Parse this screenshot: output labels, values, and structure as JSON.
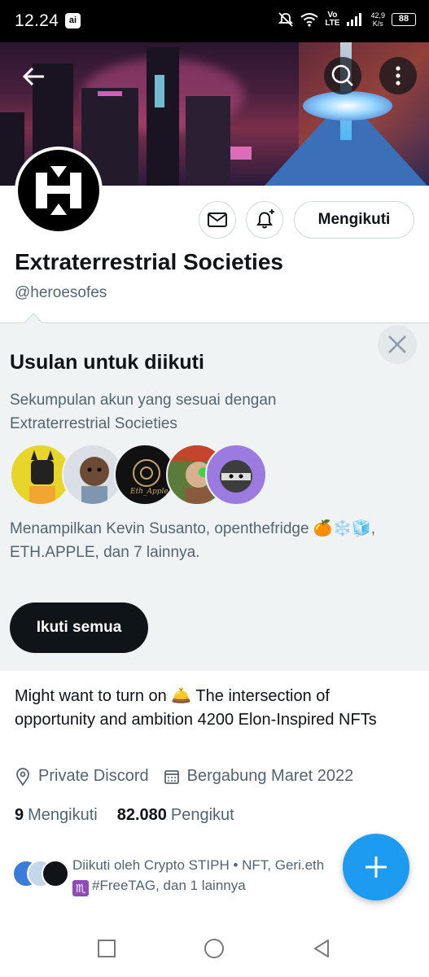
{
  "status_bar": {
    "time": "12.24",
    "ai_badge": "ai",
    "network_volte": "Vo",
    "network_lte": "LTE",
    "speed_value": "42,9",
    "speed_unit": "K/s",
    "battery": "88"
  },
  "profile": {
    "display_name": "Extraterrestrial Societies",
    "handle": "@heroesofes",
    "follow_button": "Mengikuti",
    "bio": "Might want to turn on 🛎️ The intersection of opportunity and ambition 4200 Elon-Inspired NFTs",
    "location": "Private Discord",
    "joined": "Bergabung Maret 2022",
    "following_count": "9",
    "following_label": "Mengikuti",
    "followers_count": "82.080",
    "followers_label": "Pengikut",
    "followed_by_line1": "Diikuti oleh Crypto STIPH • NFT, Geri.eth",
    "followed_by_line2": "#FreeTAG, dan 1 lainnya"
  },
  "suggestions": {
    "title": "Usulan untuk diikuti",
    "subtitle": "Sekumpulan akun yang sesuai dengan Extraterrestrial Societies",
    "showing": "Menampilkan Kevin Susanto, openthefridge 🍊❄️🧊, ETH.APPLE, dan 7 lainnya.",
    "follow_all": "Ikuti semua",
    "avatar_labels": [
      "Eth_Apple"
    ]
  },
  "icons": [
    "back-arrow-icon",
    "search-icon",
    "more-icon",
    "mail-icon",
    "bell-plus-icon",
    "close-icon",
    "location-pin-icon",
    "calendar-icon",
    "plus-icon",
    "recent-apps-icon",
    "home-icon",
    "back-nav-icon"
  ],
  "colors": {
    "accent": "#1d9bf0",
    "text_primary": "#0f1419",
    "text_secondary": "#536471",
    "suggest_bg": "#eff3f4",
    "zodiac": "#8f4bb8"
  }
}
